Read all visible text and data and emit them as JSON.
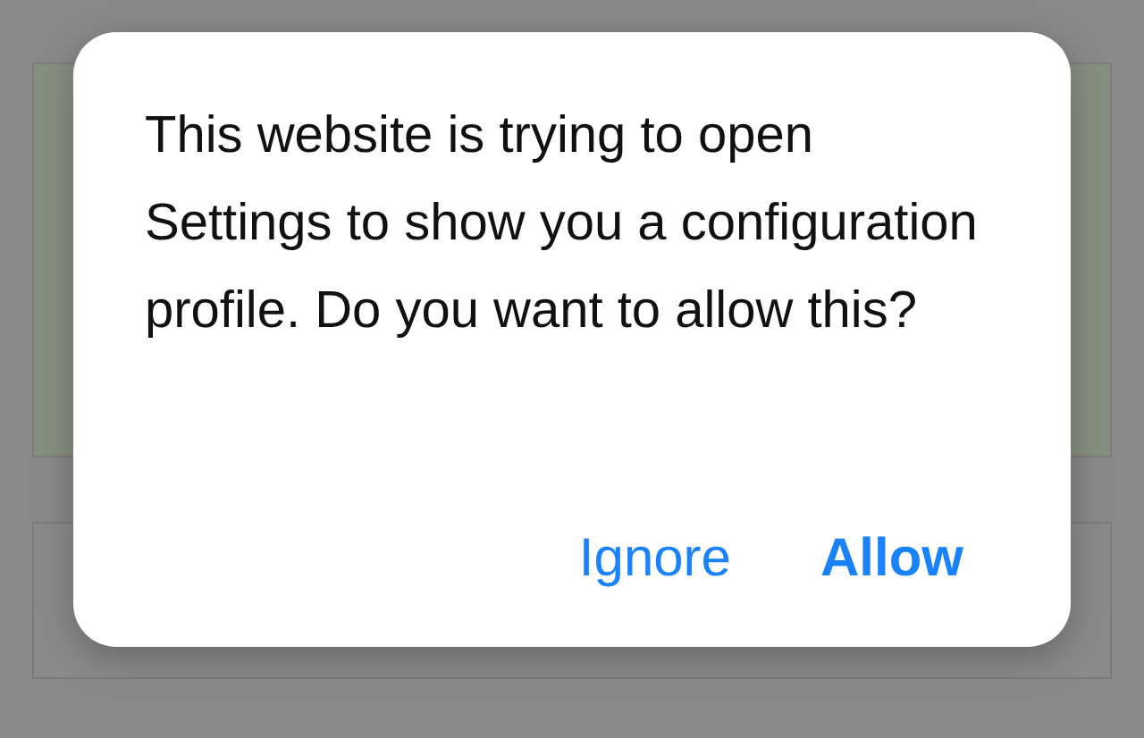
{
  "alert": {
    "message": "This website is trying to open Settings to show you a configuration profile. Do you want to allow this?",
    "buttons": [
      {
        "label": "Ignore",
        "kind": "plain"
      },
      {
        "label": "Allow",
        "kind": "bold"
      }
    ]
  }
}
